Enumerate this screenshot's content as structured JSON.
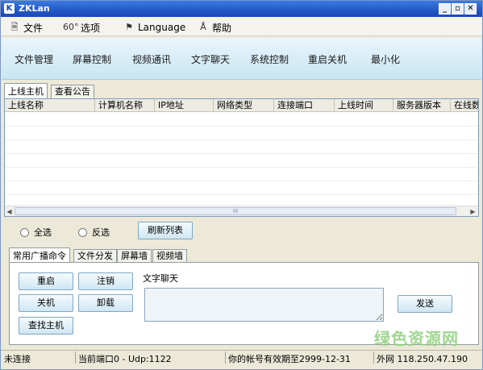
{
  "window": {
    "title": "ZKLan"
  },
  "menu": [
    {
      "label": "文件",
      "icon": "document-icon"
    },
    {
      "label": "选项",
      "icon": "options-icon"
    },
    {
      "label": "Language",
      "icon": "language-icon"
    },
    {
      "label": "帮助",
      "icon": "help-icon"
    }
  ],
  "toolbar": [
    "文件管理",
    "屏幕控制",
    "视频通讯",
    "文字聊天",
    "系统控制",
    "重启关机",
    "最小化"
  ],
  "top_tabs": [
    "上线主机",
    "查看公告"
  ],
  "columns": [
    "上线名称",
    "计算机名称",
    "IP地址",
    "网络类型",
    "连接端口",
    "上线时间",
    "服务器版本",
    "在线数"
  ],
  "scroll_grip": "III",
  "selection": {
    "select_all": "全选",
    "invert": "反选",
    "refresh": "刷新列表"
  },
  "bottom_tabs": [
    "常用广播命令",
    "文件分发",
    "屏幕墙",
    "视频墙"
  ],
  "commands": {
    "restart": "重启",
    "logoff": "注销",
    "shutdown": "关机",
    "uninstall": "卸载",
    "find_host": "查找主机"
  },
  "chat": {
    "label": "文字聊天",
    "send": "发送"
  },
  "status": {
    "connection": "未连接",
    "port": "当前端口0 - Udp:1122",
    "expiry": "你的帐号有效期至2999-12-31",
    "external_ip": "外网 118.250.47.190"
  },
  "watermark": "绿色资源网"
}
